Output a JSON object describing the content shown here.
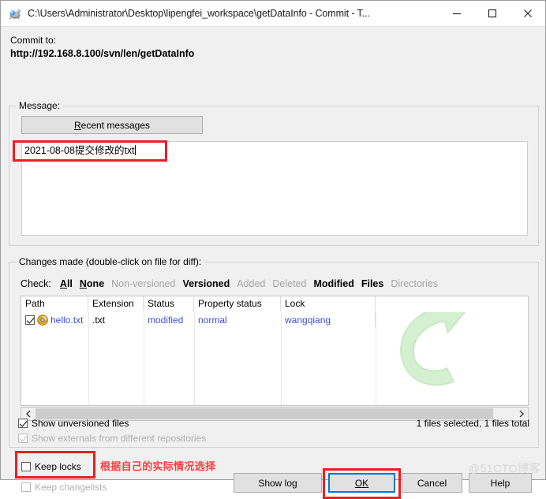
{
  "window": {
    "title": "C:\\Users\\Administrator\\Desktop\\lipengfei_workspace\\getDataInfo - Commit - T...",
    "icon": "tortoise-icon",
    "minimize_label": "─",
    "maximize_label": "□",
    "close_label": "✕"
  },
  "header": {
    "commit_to_label": "Commit to:",
    "commit_url": "http://192.168.8.100/svn/len/getDataInfo"
  },
  "message": {
    "group_title": "Message:",
    "recent_button": "Recent messages",
    "recent_button_accel": "R",
    "recent_button_rest": "ecent messages",
    "text": "2021-08-08提交修改的txt"
  },
  "changes": {
    "group_title": "Changes made (double-click on file for diff):",
    "check_label": "Check:",
    "check_links": [
      {
        "label": "All",
        "enabled": true,
        "accel": "A"
      },
      {
        "label": "None",
        "enabled": true,
        "accel": "N"
      },
      {
        "label": "Non-versioned",
        "enabled": false
      },
      {
        "label": "Versioned",
        "enabled": true
      },
      {
        "label": "Added",
        "enabled": false
      },
      {
        "label": "Deleted",
        "enabled": false
      },
      {
        "label": "Modified",
        "enabled": true
      },
      {
        "label": "Files",
        "enabled": true
      },
      {
        "label": "Directories",
        "enabled": false
      }
    ],
    "columns": [
      "Path",
      "Extension",
      "Status",
      "Property status",
      "Lock"
    ],
    "rows": [
      {
        "checked": true,
        "icon": "modified-file-icon",
        "path": "hello.txt",
        "extension": ".txt",
        "status": "modified",
        "property_status": "normal",
        "lock": "wangqiang"
      }
    ],
    "watermark_icon": "commit-arrow-watermark"
  },
  "options": {
    "show_unversioned": {
      "label": "Show unversioned files",
      "checked": true,
      "enabled": true
    },
    "show_externals": {
      "label": "Show externals from different repositories",
      "checked": true,
      "enabled": false
    },
    "keep_locks": {
      "label": "Keep locks",
      "checked": false,
      "enabled": true
    },
    "keep_changelists": {
      "label": "Keep changelists",
      "checked": false,
      "enabled": false
    },
    "files_count": "1 files selected, 1 files total"
  },
  "buttons": {
    "show_log": "Show log",
    "ok": "OK",
    "cancel": "Cancel",
    "help": "Help"
  },
  "annotations": {
    "note_text": "根据自己的实际情况选择",
    "note_color": "#fb3c3c",
    "box_color": "#ee1c25"
  },
  "watermark": {
    "text": "@51CTO博客"
  },
  "colors": {
    "link_blue": "#3b4fd8",
    "focus_blue": "#0078d7",
    "dialog_bg": "#f0f0f0",
    "disabled_gray": "#a6a6a6"
  }
}
